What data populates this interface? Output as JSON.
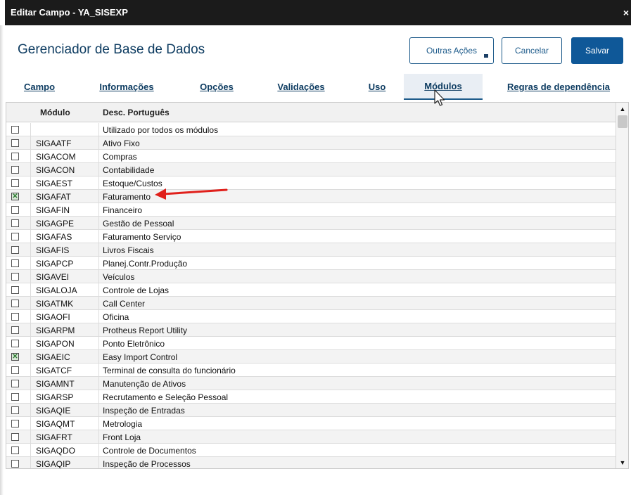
{
  "window": {
    "title": "Editar Campo - YA_SISEXP",
    "close_glyph": "×"
  },
  "header": {
    "page_title": "Gerenciador de Base de Dados",
    "outras_acoes_label": "Outras Ações",
    "cancelar_label": "Cancelar",
    "salvar_label": "Salvar"
  },
  "tabs": [
    {
      "label": "Campo",
      "active": false
    },
    {
      "label": "Informações",
      "active": false
    },
    {
      "label": "Opções",
      "active": false
    },
    {
      "label": "Validações",
      "active": false
    },
    {
      "label": "Uso",
      "active": false
    },
    {
      "label": "Módulos",
      "active": true
    },
    {
      "label": "Regras de dependência",
      "active": false
    }
  ],
  "grid": {
    "col_modulo": "Módulo",
    "col_desc": "Desc. Português",
    "rows": [
      {
        "code": "",
        "desc": "Utilizado por todos os módulos",
        "checked": false
      },
      {
        "code": "SIGAATF",
        "desc": "Ativo Fixo",
        "checked": false
      },
      {
        "code": "SIGACOM",
        "desc": "Compras",
        "checked": false
      },
      {
        "code": "SIGACON",
        "desc": "Contabilidade",
        "checked": false
      },
      {
        "code": "SIGAEST",
        "desc": "Estoque/Custos",
        "checked": false
      },
      {
        "code": "SIGAFAT",
        "desc": "Faturamento",
        "checked": true
      },
      {
        "code": "SIGAFIN",
        "desc": "Financeiro",
        "checked": false
      },
      {
        "code": "SIGAGPE",
        "desc": "Gestão de Pessoal",
        "checked": false
      },
      {
        "code": "SIGAFAS",
        "desc": "Faturamento Serviço",
        "checked": false
      },
      {
        "code": "SIGAFIS",
        "desc": "Livros Fiscais",
        "checked": false
      },
      {
        "code": "SIGAPCP",
        "desc": "Planej.Contr.Produção",
        "checked": false
      },
      {
        "code": "SIGAVEI",
        "desc": "Veículos",
        "checked": false
      },
      {
        "code": "SIGALOJA",
        "desc": "Controle de Lojas",
        "checked": false
      },
      {
        "code": "SIGATMK",
        "desc": "Call Center",
        "checked": false
      },
      {
        "code": "SIGAOFI",
        "desc": "Oficina",
        "checked": false
      },
      {
        "code": "SIGARPM",
        "desc": "Protheus Report Utility",
        "checked": false
      },
      {
        "code": "SIGAPON",
        "desc": "Ponto Eletrônico",
        "checked": false
      },
      {
        "code": "SIGAEIC",
        "desc": "Easy Import Control",
        "checked": true
      },
      {
        "code": "SIGATCF",
        "desc": "Terminal de consulta do funcionário",
        "checked": false
      },
      {
        "code": "SIGAMNT",
        "desc": "Manutenção de Ativos",
        "checked": false
      },
      {
        "code": "SIGARSP",
        "desc": "Recrutamento e Seleção Pessoal",
        "checked": false
      },
      {
        "code": "SIGAQIE",
        "desc": "Inspeção de Entradas",
        "checked": false
      },
      {
        "code": "SIGAQMT",
        "desc": "Metrologia",
        "checked": false
      },
      {
        "code": "SIGAFRT",
        "desc": "Front Loja",
        "checked": false
      },
      {
        "code": "SIGAQDO",
        "desc": "Controle de Documentos",
        "checked": false
      },
      {
        "code": "SIGAQIP",
        "desc": "Inspeção de Processos",
        "checked": false
      }
    ],
    "check_glyph": "✕"
  },
  "colors": {
    "titlebar": "#1b1b1b",
    "primary": "#0f5898",
    "accent_text": "#0f3d62",
    "annotation_arrow": "#e0201b"
  },
  "icons": {
    "scroll_up": "▲",
    "scroll_down": "▼"
  }
}
